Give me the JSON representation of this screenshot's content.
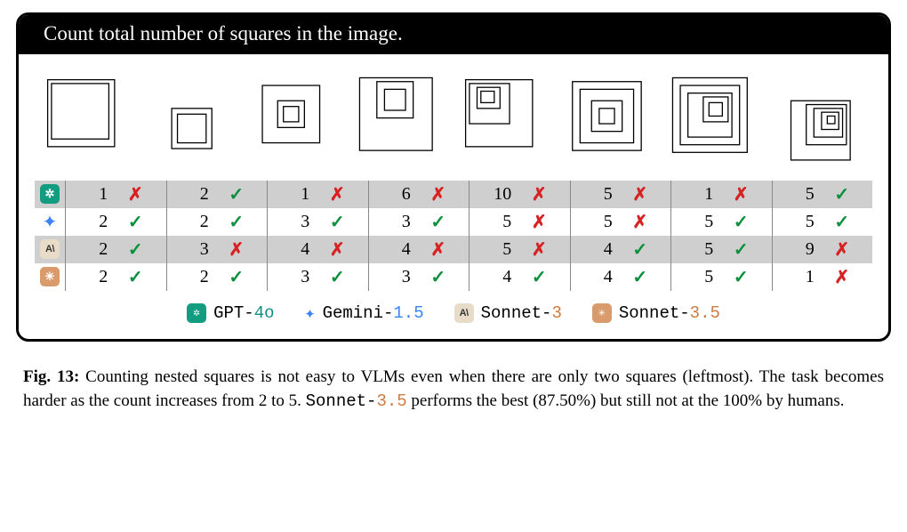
{
  "title": "Count total number of squares in the image.",
  "models": [
    {
      "id": "gpt4o",
      "label_prefix": "GPT-",
      "label_suffix": "4o",
      "accent": "accent-teal"
    },
    {
      "id": "gemini15",
      "label_prefix": "Gemini-",
      "label_suffix": "1.5",
      "accent": "accent-blue"
    },
    {
      "id": "sonnet3",
      "label_prefix": "Sonnet-",
      "label_suffix": "3",
      "accent": "accent-orange"
    },
    {
      "id": "sonnet35",
      "label_prefix": "Sonnet-",
      "label_suffix": "3.5",
      "accent": "accent-orange"
    }
  ],
  "chart_data": {
    "type": "table",
    "title": "Model answers to 'count total number of squares' across 8 nested-square images",
    "columns": [
      "img1",
      "img2",
      "img3",
      "img4",
      "img5",
      "img6",
      "img7",
      "img8"
    ],
    "ground_truth": [
      2,
      2,
      3,
      3,
      4,
      4,
      5,
      5
    ],
    "series": [
      {
        "name": "GPT-4o",
        "answers": [
          1,
          2,
          1,
          6,
          10,
          5,
          1,
          5
        ],
        "correct": [
          false,
          true,
          false,
          false,
          false,
          false,
          false,
          true
        ]
      },
      {
        "name": "Gemini-1.5",
        "answers": [
          2,
          2,
          3,
          3,
          5,
          5,
          5,
          5
        ],
        "correct": [
          true,
          true,
          true,
          true,
          false,
          false,
          true,
          true
        ]
      },
      {
        "name": "Sonnet-3",
        "answers": [
          2,
          3,
          4,
          4,
          5,
          4,
          5,
          9
        ],
        "correct": [
          true,
          false,
          false,
          false,
          false,
          true,
          true,
          false
        ]
      },
      {
        "name": "Sonnet-3.5",
        "answers": [
          2,
          2,
          3,
          3,
          4,
          4,
          5,
          1
        ],
        "correct": [
          true,
          true,
          true,
          true,
          true,
          true,
          true,
          false
        ]
      }
    ]
  },
  "caption": {
    "fig_label": "Fig. 13:",
    "text1": " Counting nested squares is not easy to VLMs even when there are only two squares (leftmost). The task becomes harder as the count increases from 2 to 5. ",
    "model_prefix": "Sonnet-",
    "model_suffix": "3.5",
    "text2": " performs the best (87.50%) but still not at the 100% by humans."
  }
}
